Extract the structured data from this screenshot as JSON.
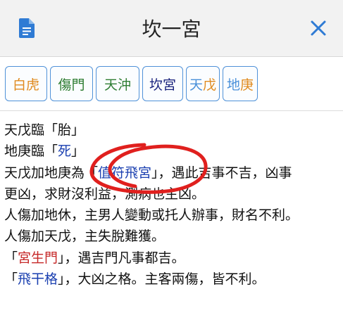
{
  "header": {
    "title": "坎一宮",
    "left_icon": "document-icon",
    "right_icon": "close-icon",
    "accent": "#2f7bd4"
  },
  "chips": [
    {
      "parts": [
        {
          "text": "白虎",
          "color": "#e08a1e"
        }
      ]
    },
    {
      "parts": [
        {
          "text": "傷門",
          "color": "#2e7d32"
        }
      ]
    },
    {
      "parts": [
        {
          "text": "天沖",
          "color": "#2e7d32"
        }
      ]
    },
    {
      "parts": [
        {
          "text": "坎宮",
          "color": "#1a237e"
        }
      ]
    },
    {
      "parts": [
        {
          "text": "天",
          "color": "#4a90d9"
        },
        {
          "text": "戊",
          "color": "#e08a1e"
        }
      ]
    },
    {
      "parts": [
        {
          "text": "地",
          "color": "#4a90d9"
        },
        {
          "text": "庚",
          "color": "#e08a1e"
        }
      ]
    }
  ],
  "lines": [
    [
      {
        "text": "天戊臨「胎」"
      }
    ],
    [
      {
        "text": "地庚臨「"
      },
      {
        "text": "死",
        "color": "#1a3fb0"
      },
      {
        "text": "」"
      }
    ],
    [
      {
        "text": "天戊加地庚為「"
      },
      {
        "text": "值符飛宮",
        "color": "#1a3fb0"
      },
      {
        "text": "」，遇此吉事不吉，凶事"
      }
    ],
    [
      {
        "text": "更凶，求財沒利益，測病也主凶。"
      }
    ],
    [
      {
        "text": "人傷加地休，主男人變動或托人辦事，財名不利。"
      }
    ],
    [
      {
        "text": "人傷加天戊，主失脫難獲。"
      }
    ],
    [
      {
        "text": "「"
      },
      {
        "text": "宮生門",
        "color": "#c62828"
      },
      {
        "text": "」，遇吉門凡事都吉。"
      }
    ],
    [
      {
        "text": "「"
      },
      {
        "text": "飛干格",
        "color": "#1a3fb0"
      },
      {
        "text": "」，大凶之格。主客兩傷，皆不利。"
      }
    ]
  ],
  "annotation": {
    "color": "#e0201e"
  }
}
